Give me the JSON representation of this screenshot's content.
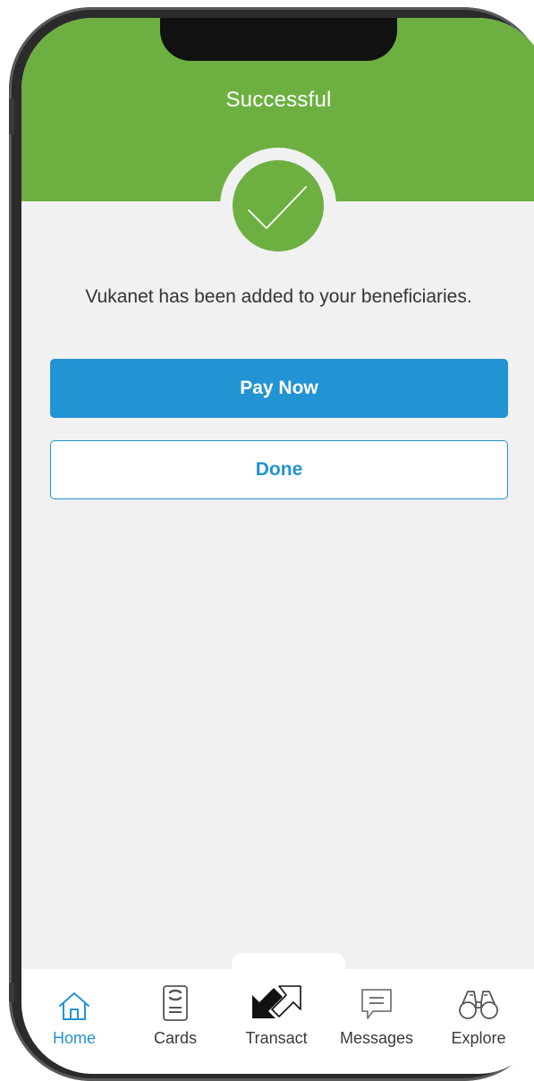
{
  "header": {
    "title": "Successful"
  },
  "message": {
    "text": "Vukanet has been added to your beneficiaries."
  },
  "actions": {
    "pay_now_label": "Pay Now",
    "done_label": "Done"
  },
  "tabbar": {
    "items": [
      {
        "label": "Home",
        "icon": "home-icon",
        "active": true
      },
      {
        "label": "Cards",
        "icon": "card-icon",
        "active": false
      },
      {
        "label": "Transact",
        "icon": "transact-arrows-icon",
        "active": false
      },
      {
        "label": "Messages",
        "icon": "message-icon",
        "active": false
      },
      {
        "label": "Explore",
        "icon": "binoculars-icon",
        "active": false
      }
    ]
  },
  "colors": {
    "brand_green": "#6db041",
    "accent_blue": "#2293d3",
    "background": "#f1f1f1"
  }
}
